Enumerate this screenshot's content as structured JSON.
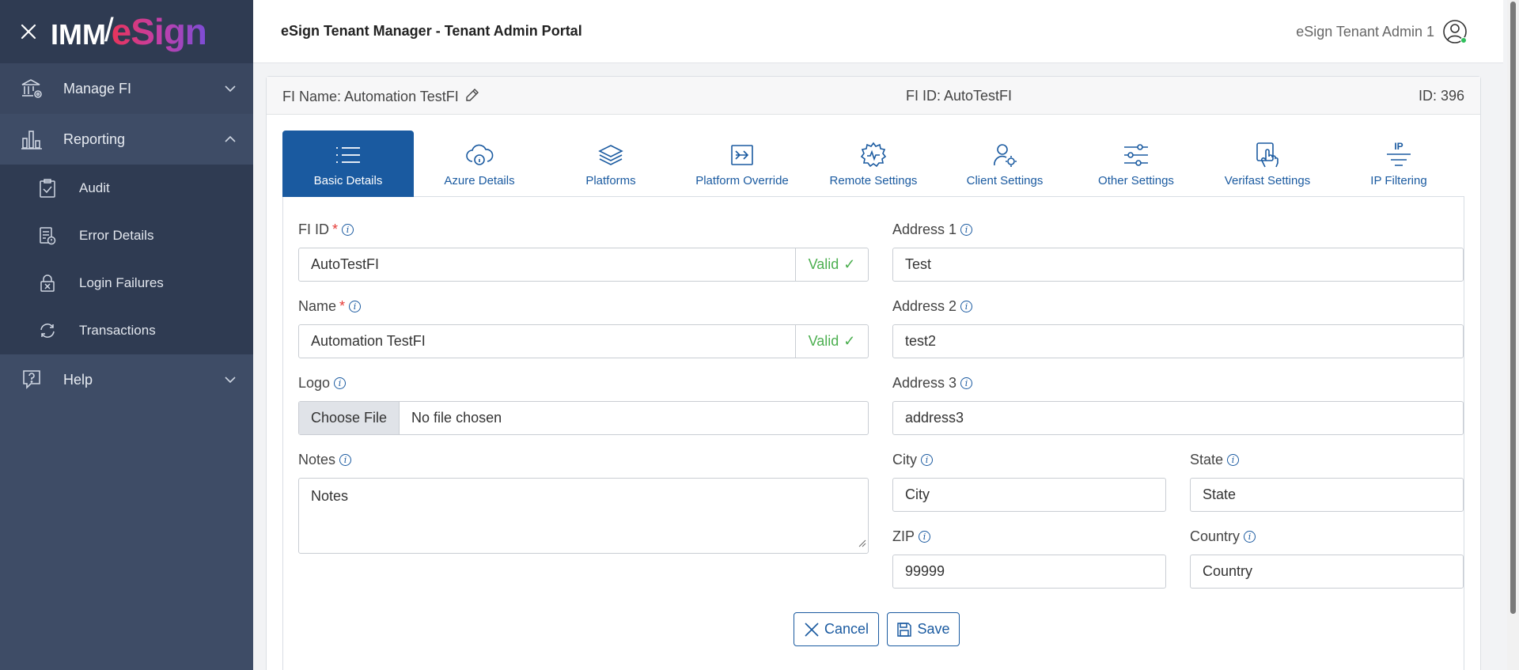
{
  "brand": {
    "imm": "IMM",
    "slash": "/",
    "esign": "eSign"
  },
  "sidebar": {
    "manage_fi": "Manage FI",
    "reporting": "Reporting",
    "reporting_items": [
      "Audit",
      "Error Details",
      "Login Failures",
      "Transactions"
    ],
    "help": "Help"
  },
  "header": {
    "title": "eSign Tenant Manager - Tenant Admin Portal",
    "user": "eSign Tenant Admin 1"
  },
  "card": {
    "fi_name": "FI Name: Automation TestFI",
    "fi_id": "FI ID: AutoTestFI",
    "id": "ID: 396"
  },
  "tabs": [
    {
      "label": "Basic Details",
      "icon": "list-icon",
      "active": true
    },
    {
      "label": "Azure Details",
      "icon": "cloud-info-icon"
    },
    {
      "label": "Platforms",
      "icon": "layers-icon"
    },
    {
      "label": "Platform Override",
      "icon": "arrow-box-icon"
    },
    {
      "label": "Remote Settings",
      "icon": "gear-pulse-icon"
    },
    {
      "label": "Client Settings",
      "icon": "user-gear-icon"
    },
    {
      "label": "Other Settings",
      "icon": "sliders-icon"
    },
    {
      "label": "Verifast Settings",
      "icon": "hand-touch-icon"
    },
    {
      "label": "IP Filtering",
      "icon": "ip-filter-icon",
      "badge": "IP"
    }
  ],
  "form": {
    "fi_id": {
      "label": "FI ID",
      "required": "*",
      "value": "AutoTestFI",
      "status": "Valid",
      "check": "✓"
    },
    "name": {
      "label": "Name",
      "required": "*",
      "value": "Automation TestFI",
      "status": "Valid",
      "check": "✓"
    },
    "logo": {
      "label": "Logo",
      "button": "Choose File",
      "text": "No file chosen"
    },
    "notes": {
      "label": "Notes",
      "value": "Notes"
    },
    "address1": {
      "label": "Address 1",
      "value": "Test"
    },
    "address2": {
      "label": "Address 2",
      "value": "test2"
    },
    "address3": {
      "label": "Address 3",
      "value": "address3"
    },
    "city": {
      "label": "City",
      "value": "City"
    },
    "state": {
      "label": "State",
      "value": "State"
    },
    "zip": {
      "label": "ZIP",
      "value": "99999"
    },
    "country": {
      "label": "Country",
      "value": "Country"
    },
    "info_glyph": "i"
  },
  "actions": {
    "cancel": "Cancel",
    "save": "Save"
  },
  "colors": {
    "primary": "#1a5aa0",
    "sidebar": "#3e4c66",
    "valid": "#4caf50",
    "required": "#e53935"
  }
}
